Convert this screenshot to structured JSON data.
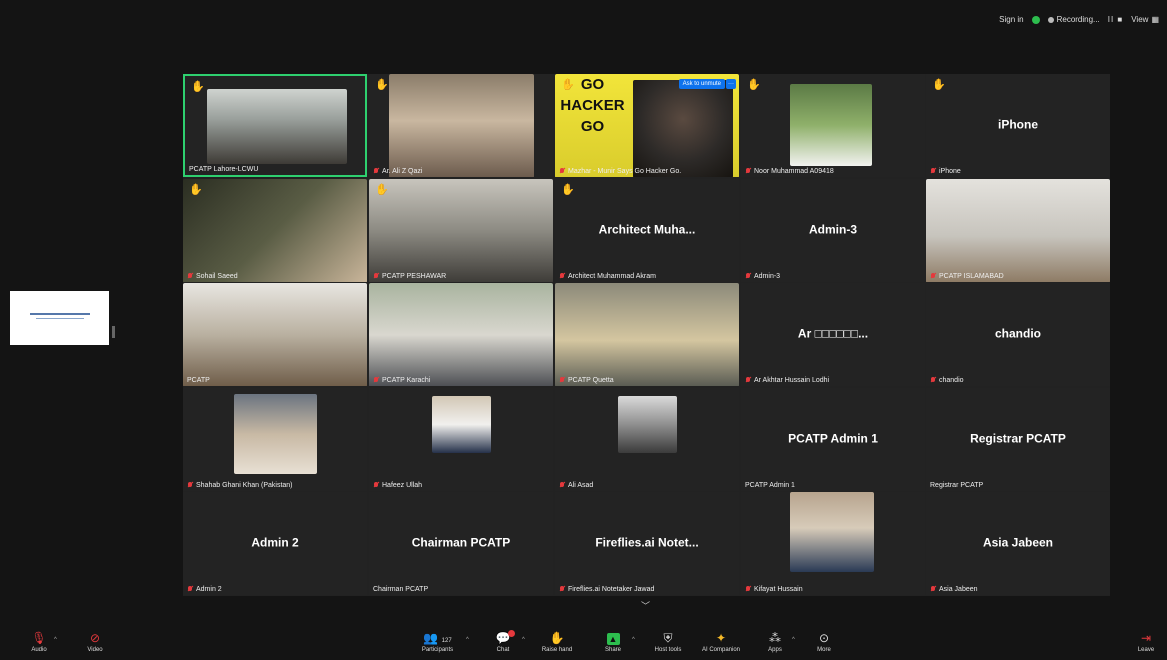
{
  "topbar": {
    "sign_in": "Sign in",
    "recording": "Recording...",
    "recording_controls": "II ■",
    "view": "View"
  },
  "share": {
    "title": "AUDITED FINANCIAL STATEMENTS"
  },
  "tiles": [
    {
      "name": "PCATP Lahore-LCWU",
      "type": "video",
      "hand": true,
      "active": true,
      "muted": false
    },
    {
      "name": "Ar. Ali Z Qazi",
      "type": "video",
      "hand": true,
      "muted": true
    },
    {
      "name": "Mazhar - Munir Says Go Hacker Go.",
      "type": "video",
      "hand": true,
      "muted": true,
      "ask_unmute": "Ask to unmute",
      "more": "···",
      "sign_text": [
        "GO",
        "HACKER",
        "GO"
      ]
    },
    {
      "name": "Noor Muhammad  A09418",
      "type": "photo",
      "hand": true,
      "muted": true
    },
    {
      "name": "iPhone",
      "type": "text",
      "display": "iPhone",
      "hand": true,
      "muted": true
    },
    {
      "name": "Sohail Saeed",
      "type": "video",
      "hand": true,
      "muted": true
    },
    {
      "name": "PCATP PESHAWAR",
      "type": "video",
      "hand": true,
      "muted": true
    },
    {
      "name": "Architect Muhammad Akram",
      "type": "text",
      "display": "Architect  Muha...",
      "hand": true,
      "muted": true
    },
    {
      "name": "Admin-3",
      "type": "text",
      "display": "Admin-3",
      "muted": true
    },
    {
      "name": "PCATP ISLAMABAD",
      "type": "video",
      "muted": true
    },
    {
      "name": "PCATP",
      "type": "video",
      "muted": false
    },
    {
      "name": "PCATP Karachi",
      "type": "video",
      "muted": true
    },
    {
      "name": "PCATP Quetta",
      "type": "video",
      "muted": true
    },
    {
      "name": "Ar Akhtar Hussain Lodhi",
      "type": "text",
      "display": "Ar □□□□□□...",
      "muted": true
    },
    {
      "name": "chandio",
      "type": "text",
      "display": "chandio",
      "muted": true
    },
    {
      "name": "Shahab Ghani Khan (Pakistan)",
      "type": "photo",
      "muted": true
    },
    {
      "name": "Hafeez Ullah",
      "type": "photo",
      "muted": true
    },
    {
      "name": "Ali Asad",
      "type": "photo",
      "muted": true
    },
    {
      "name": "PCATP Admin 1",
      "type": "text",
      "display": "PCATP Admin 1",
      "muted": false
    },
    {
      "name": "Registrar PCATP",
      "type": "text",
      "display": "Registrar PCATP",
      "muted": false
    },
    {
      "name": "Admin 2",
      "type": "text",
      "display": "Admin 2",
      "muted": true
    },
    {
      "name": "Chairman PCATP",
      "type": "text",
      "display": "Chairman PCATP",
      "muted": false
    },
    {
      "name": "Fireflies.ai Notetaker Jawad",
      "type": "text",
      "display": "Fireflies.ai  Notet...",
      "muted": true
    },
    {
      "name": "Kifayat Hussain",
      "type": "photo",
      "muted": true
    },
    {
      "name": "Asia Jabeen",
      "type": "text",
      "display": "Asia Jabeen",
      "muted": true
    }
  ],
  "toolbar": {
    "audio": "Audio",
    "video": "Video",
    "participants": "Participants",
    "participants_count": "127",
    "chat": "Chat",
    "raise_hand": "Raise hand",
    "share": "Share",
    "host_tools": "Host tools",
    "ai_companion": "AI Companion",
    "apps": "Apps",
    "more": "More",
    "leave": "Leave"
  },
  "colors": {
    "background": "#141414",
    "tile": "#232323",
    "active_border": "#2ed06f",
    "muted_icon": "#e5393d",
    "hand": "#f5b928",
    "accent_blue": "#0e72ed"
  }
}
